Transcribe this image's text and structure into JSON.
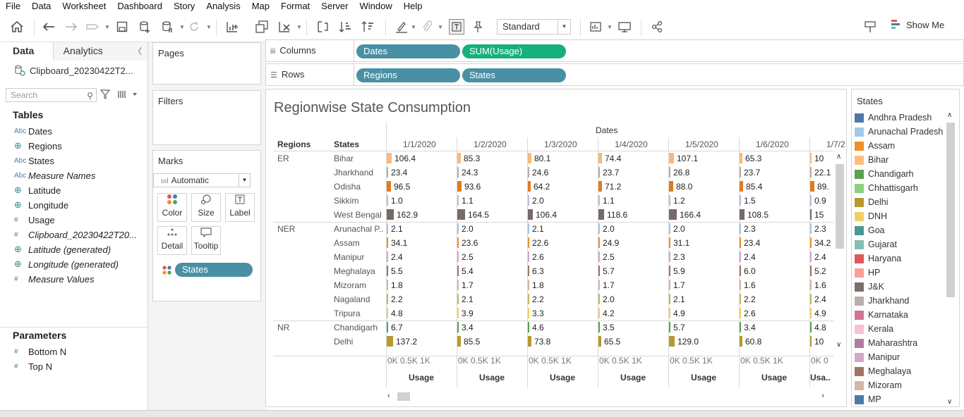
{
  "menu": [
    "File",
    "Data",
    "Worksheet",
    "Dashboard",
    "Story",
    "Analysis",
    "Map",
    "Format",
    "Server",
    "Window",
    "Help"
  ],
  "toolbar": {
    "standard_label": "Standard",
    "show_me_label": "Show Me"
  },
  "data_pane": {
    "tab_data": "Data",
    "tab_analytics": "Analytics",
    "datasource": "Clipboard_20230422T2...",
    "search_placeholder": "Search",
    "tables_heading": "Tables",
    "fields": [
      {
        "icon": "Abc",
        "name": "Dates"
      },
      {
        "icon": "⊕",
        "name": "Regions"
      },
      {
        "icon": "Abc",
        "name": "States"
      },
      {
        "icon": "Abc",
        "name": "Measure Names"
      },
      {
        "icon": "⊕",
        "name": "Latitude"
      },
      {
        "icon": "⊕",
        "name": "Longitude"
      },
      {
        "icon": "#",
        "name": "Usage"
      },
      {
        "icon": "#",
        "name": "Clipboard_20230422T20..."
      },
      {
        "icon": "⊕",
        "name": "Latitude (generated)"
      },
      {
        "icon": "⊕",
        "name": "Longitude (generated)"
      },
      {
        "icon": "#",
        "name": "Measure Values"
      }
    ],
    "parameters_heading": "Parameters",
    "parameters": [
      {
        "icon": "#",
        "name": "Bottom N"
      },
      {
        "icon": "#",
        "name": "Top N"
      }
    ]
  },
  "cards": {
    "pages": "Pages",
    "filters": "Filters",
    "marks": "Marks",
    "mark_type": "Automatic",
    "mark_buttons": [
      "Color",
      "Size",
      "Label",
      "Detail",
      "Tooltip"
    ],
    "marks_pill": "States"
  },
  "shelves": {
    "columns_label": "Columns",
    "rows_label": "Rows",
    "columns_pills": [
      "Dates",
      "SUM(Usage)"
    ],
    "rows_pills": [
      "Regions",
      "States"
    ]
  },
  "viz": {
    "title": "Regionwise State Consumption",
    "dates_header": "Dates",
    "regions_header": "Regions",
    "states_header": "States",
    "axis_ticks": [
      "0K",
      "0.5K",
      "1K"
    ],
    "axis_title": "Usage",
    "axis_title_last": "Usa..",
    "axis_ticks_last": "0K 0"
  },
  "chart_data": {
    "type": "bar",
    "title": "Regionwise State Consumption",
    "xlabel": "Usage",
    "columns": [
      "1/1/2020",
      "1/2/2020",
      "1/3/2020",
      "1/4/2020",
      "1/5/2020",
      "1/6/2020",
      "1/7/2"
    ],
    "rows": [
      {
        "region": "ER",
        "state": "Bihar",
        "color": "#f9b97a",
        "values": [
          "106.4",
          "85.3",
          "80.1",
          "74.4",
          "107.1",
          "65.3",
          "10"
        ]
      },
      {
        "region": "",
        "state": "Jharkhand",
        "color": "#b9aca7",
        "values": [
          "23.4",
          "24.3",
          "24.6",
          "23.7",
          "26.8",
          "23.7",
          "22.1"
        ]
      },
      {
        "region": "",
        "state": "Odisha",
        "color": "#e07b1f",
        "values": [
          "96.5",
          "93.6",
          "64.2",
          "71.2",
          "88.0",
          "85.4",
          "89."
        ]
      },
      {
        "region": "",
        "state": "Sikkim",
        "color": "#c7b7d9",
        "values": [
          "1.0",
          "1.1",
          "2.0",
          "1.1",
          "1.2",
          "1.5",
          "0.9"
        ]
      },
      {
        "region": "",
        "state": "West Bengal",
        "color": "#756b67",
        "values": [
          "162.9",
          "164.5",
          "106.4",
          "118.6",
          "166.4",
          "108.5",
          "15"
        ]
      },
      {
        "region": "NER",
        "state": "Arunachal P..",
        "color": "#9ec7e8",
        "values": [
          "2.1",
          "2.0",
          "2.1",
          "2.0",
          "2.0",
          "2.3",
          "2.3"
        ]
      },
      {
        "region": "",
        "state": "Assam",
        "color": "#f28e2b",
        "values": [
          "34.1",
          "23.6",
          "22.6",
          "24.9",
          "31.1",
          "23.4",
          "34.2"
        ]
      },
      {
        "region": "",
        "state": "Manipur",
        "color": "#d4a6c8",
        "values": [
          "2.4",
          "2.5",
          "2.6",
          "2.5",
          "2.3",
          "2.4",
          "2.4"
        ]
      },
      {
        "region": "",
        "state": "Meghalaya",
        "color": "#9d7660",
        "values": [
          "5.5",
          "5.4",
          "6.3",
          "5.7",
          "5.9",
          "6.0",
          "5.2"
        ]
      },
      {
        "region": "",
        "state": "Mizoram",
        "color": "#d7b5a6",
        "values": [
          "1.8",
          "1.7",
          "1.8",
          "1.7",
          "1.7",
          "1.6",
          "1.6"
        ]
      },
      {
        "region": "",
        "state": "Nagaland",
        "color": "#bfbb60",
        "values": [
          "2.2",
          "2.1",
          "2.2",
          "2.0",
          "2.1",
          "2.2",
          "2.4"
        ]
      },
      {
        "region": "",
        "state": "Tripura",
        "color": "#f1ce63",
        "values": [
          "4.8",
          "3.9",
          "3.3",
          "4.2",
          "4.9",
          "2.6",
          "4.9"
        ]
      },
      {
        "region": "NR",
        "state": "Chandigarh",
        "color": "#59a14f",
        "values": [
          "6.7",
          "3.4",
          "4.6",
          "3.5",
          "5.7",
          "3.4",
          "4.8"
        ]
      },
      {
        "region": "",
        "state": "Delhi",
        "color": "#b6992d",
        "values": [
          "137.2",
          "85.5",
          "73.8",
          "65.5",
          "129.0",
          "60.8",
          "10"
        ]
      }
    ]
  },
  "legend": {
    "title": "States",
    "items": [
      {
        "name": "Andhra Pradesh",
        "color": "#4e79a7"
      },
      {
        "name": "Arunachal Pradesh",
        "color": "#a0cbe8"
      },
      {
        "name": "Assam",
        "color": "#f28e2b"
      },
      {
        "name": "Bihar",
        "color": "#ffbe7d"
      },
      {
        "name": "Chandigarh",
        "color": "#59a14f"
      },
      {
        "name": "Chhattisgarh",
        "color": "#8cd17d"
      },
      {
        "name": "Delhi",
        "color": "#b6992d"
      },
      {
        "name": "DNH",
        "color": "#f1ce63"
      },
      {
        "name": "Goa",
        "color": "#499894"
      },
      {
        "name": "Gujarat",
        "color": "#86bcb6"
      },
      {
        "name": "Haryana",
        "color": "#e15759"
      },
      {
        "name": "HP",
        "color": "#ff9d9a"
      },
      {
        "name": "J&K",
        "color": "#79706e"
      },
      {
        "name": "Jharkhand",
        "color": "#bab0ac"
      },
      {
        "name": "Karnataka",
        "color": "#d37295"
      },
      {
        "name": "Kerala",
        "color": "#fabfd2"
      },
      {
        "name": "Maharashtra",
        "color": "#b07aa1"
      },
      {
        "name": "Manipur",
        "color": "#d4a6c8"
      },
      {
        "name": "Meghalaya",
        "color": "#9d7660"
      },
      {
        "name": "Mizoram",
        "color": "#d7b5a6"
      },
      {
        "name": "MP",
        "color": "#4e79a7"
      }
    ]
  }
}
